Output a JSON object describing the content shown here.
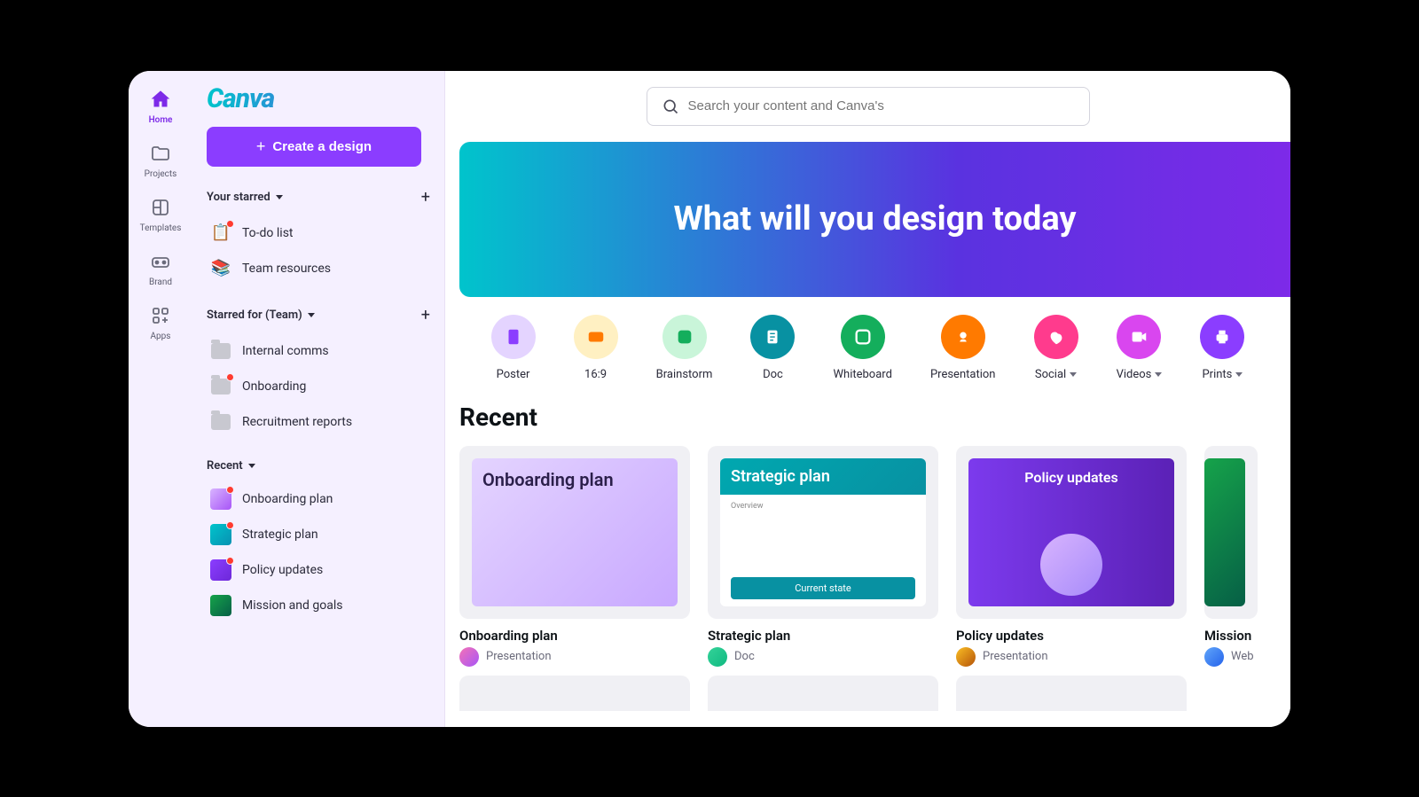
{
  "logo": "Canva",
  "rail": [
    {
      "label": "Home",
      "icon": "home"
    },
    {
      "label": "Projects",
      "icon": "folder"
    },
    {
      "label": "Templates",
      "icon": "layout"
    },
    {
      "label": "Brand",
      "icon": "brand"
    },
    {
      "label": "Apps",
      "icon": "apps"
    }
  ],
  "create_button": "Create a design",
  "sections": {
    "starred": {
      "title": "Your starred",
      "items": [
        {
          "label": "To-do list",
          "icon": "clipboard",
          "dot": true
        },
        {
          "label": "Team resources",
          "icon": "books",
          "dot": false
        }
      ]
    },
    "starred_team": {
      "title": "Starred for (Team)",
      "items": [
        {
          "label": "Internal comms",
          "dot": false
        },
        {
          "label": "Onboarding",
          "dot": true
        },
        {
          "label": "Recruitment reports",
          "dot": false
        }
      ]
    },
    "recent": {
      "title": "Recent",
      "items": [
        {
          "label": "Onboarding plan",
          "thumb": "t1",
          "dot": true
        },
        {
          "label": "Strategic plan",
          "thumb": "t2",
          "dot": true
        },
        {
          "label": "Policy updates",
          "thumb": "t3",
          "dot": true
        },
        {
          "label": "Mission and goals",
          "thumb": "t4",
          "dot": false
        }
      ]
    }
  },
  "search_placeholder": "Search your content and Canva's",
  "hero": "What will you design today",
  "categories": [
    {
      "label": "Poster",
      "color": "#e4d4ff",
      "icon_color": "#8b3dff",
      "chevron": false
    },
    {
      "label": "16:9",
      "color": "#fff0c2",
      "icon_color": "#ff7a00",
      "chevron": false
    },
    {
      "label": "Brainstorm",
      "color": "#c9f5d9",
      "icon_color": "#14ae5c",
      "chevron": false
    },
    {
      "label": "Doc",
      "color": "#0891a2",
      "icon_color": "#fff",
      "chevron": false
    },
    {
      "label": "Whiteboard",
      "color": "#14ae5c",
      "icon_color": "#fff",
      "chevron": false
    },
    {
      "label": "Presentation",
      "color": "#ff7a00",
      "icon_color": "#fff",
      "chevron": false
    },
    {
      "label": "Social",
      "color": "#ff3b8d",
      "icon_color": "#fff",
      "chevron": true
    },
    {
      "label": "Videos",
      "color": "#d946ef",
      "icon_color": "#fff",
      "chevron": true
    },
    {
      "label": "Prints",
      "color": "#8b3dff",
      "icon_color": "#fff",
      "chevron": true
    }
  ],
  "recent_heading": "Recent",
  "cards": [
    {
      "title": "Onboarding plan",
      "type": "Presentation",
      "mock": "m1",
      "mock_text": "Onboarding plan"
    },
    {
      "title": "Strategic plan",
      "type": "Doc",
      "mock": "m2",
      "mock_text": "Strategic plan",
      "mock_sub": "Overview",
      "mock_btn": "Current state"
    },
    {
      "title": "Policy updates",
      "type": "Presentation",
      "mock": "m3",
      "mock_text": "Policy updates"
    },
    {
      "title": "Mission",
      "type": "Web",
      "mock": "m4"
    }
  ]
}
